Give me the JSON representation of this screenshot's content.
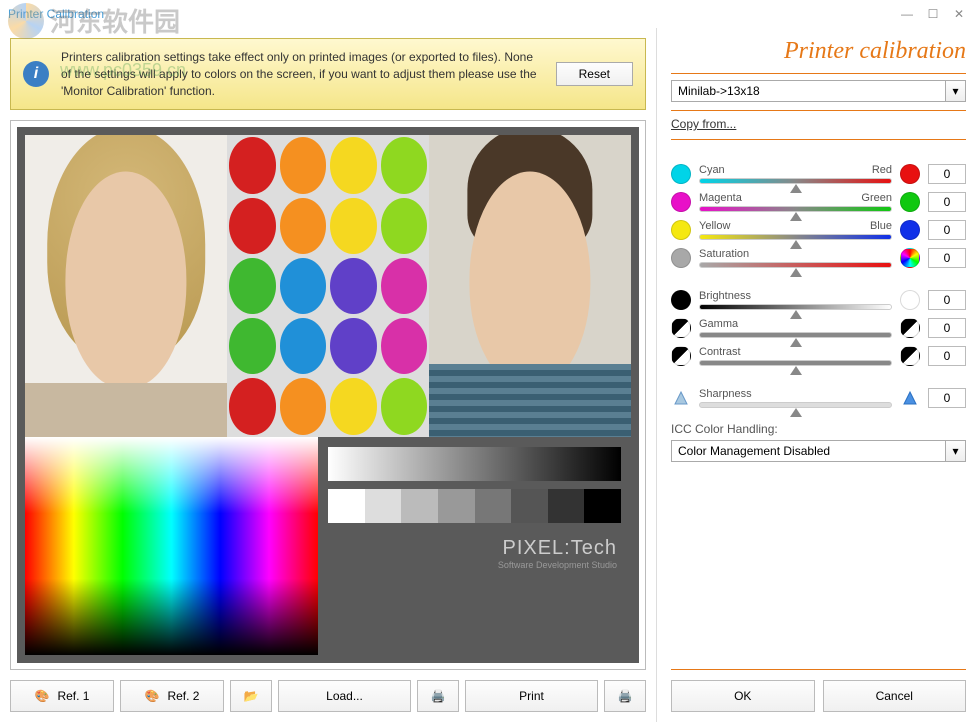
{
  "window": {
    "title": "Printer Calibration"
  },
  "watermark": {
    "site": "河东软件园",
    "url": "www.pc0359.cn"
  },
  "info": {
    "text": "Printers calibration settings take effect only on printed images (or exported to files). None of the settings will apply to colors on the screen, if you want to adjust them please use the 'Monitor Calibration' function.",
    "reset_label": "Reset"
  },
  "panel": {
    "title": "Printer calibration",
    "profile": "Minilab->13x18",
    "copy_from": "Copy from...",
    "icc_label": "ICC Color Handling:",
    "icc_value": "Color Management Disabled"
  },
  "sliders": [
    {
      "left_label": "Cyan",
      "right_label": "Red",
      "left_color": "#00d4e8",
      "right_color": "#e81010",
      "track": "linear-gradient(to right,#00d4e8,#888,#e81010)",
      "value": "0"
    },
    {
      "left_label": "Magenta",
      "right_label": "Green",
      "left_color": "#e810c8",
      "right_color": "#10c810",
      "track": "linear-gradient(to right,#e810c8,#888,#10c810)",
      "value": "0"
    },
    {
      "left_label": "Yellow",
      "right_label": "Blue",
      "left_color": "#f5e810",
      "right_color": "#1030e8",
      "track": "linear-gradient(to right,#f5e810,#888,#1030e8)",
      "value": "0"
    },
    {
      "left_label": "Saturation",
      "right_label": "",
      "left_color": "#a8a8a8",
      "right_icon": "conic",
      "track": "linear-gradient(to right,#a8a8a8,#e81010)",
      "value": "0"
    },
    {
      "left_label": "Brightness",
      "right_label": "",
      "left_color": "#000",
      "right_color": "#fff",
      "track": "linear-gradient(to right,#000,#fff)",
      "value": "0"
    },
    {
      "left_label": "Gamma",
      "right_label": "",
      "left_icon": "half",
      "right_icon": "half",
      "track": "linear-gradient(to right,#888,#888)",
      "value": "0"
    },
    {
      "left_label": "Contrast",
      "right_label": "",
      "left_icon": "half",
      "right_icon": "half",
      "track": "linear-gradient(to right,#888,#888)",
      "value": "0"
    },
    {
      "left_label": "Sharpness",
      "right_label": "",
      "left_icon": "tri",
      "right_icon": "tri",
      "track": "linear-gradient(to right,#ddd,#ddd)",
      "value": "0"
    }
  ],
  "buttons": {
    "ref1": "Ref. 1",
    "ref2": "Ref. 2",
    "load": "Load...",
    "print": "Print",
    "ok": "OK",
    "cancel": "Cancel"
  },
  "brand": {
    "name": "PIXEL:Tech",
    "tagline": "Software Development Studio"
  },
  "gray_steps": [
    "#ffffff",
    "#dddddd",
    "#bbbbbb",
    "#999999",
    "#777777",
    "#555555",
    "#333333",
    "#000000"
  ],
  "cupcake_colors": [
    "#d42020",
    "#f59020",
    "#f5d820",
    "#8fd820",
    "#d42020",
    "#f59020",
    "#f5d820",
    "#8fd820",
    "#3fb830",
    "#2090d8",
    "#6040c8",
    "#d830a8",
    "#3fb830",
    "#2090d8",
    "#6040c8",
    "#d830a8",
    "#d42020",
    "#f59020",
    "#f5d820",
    "#8fd820"
  ]
}
